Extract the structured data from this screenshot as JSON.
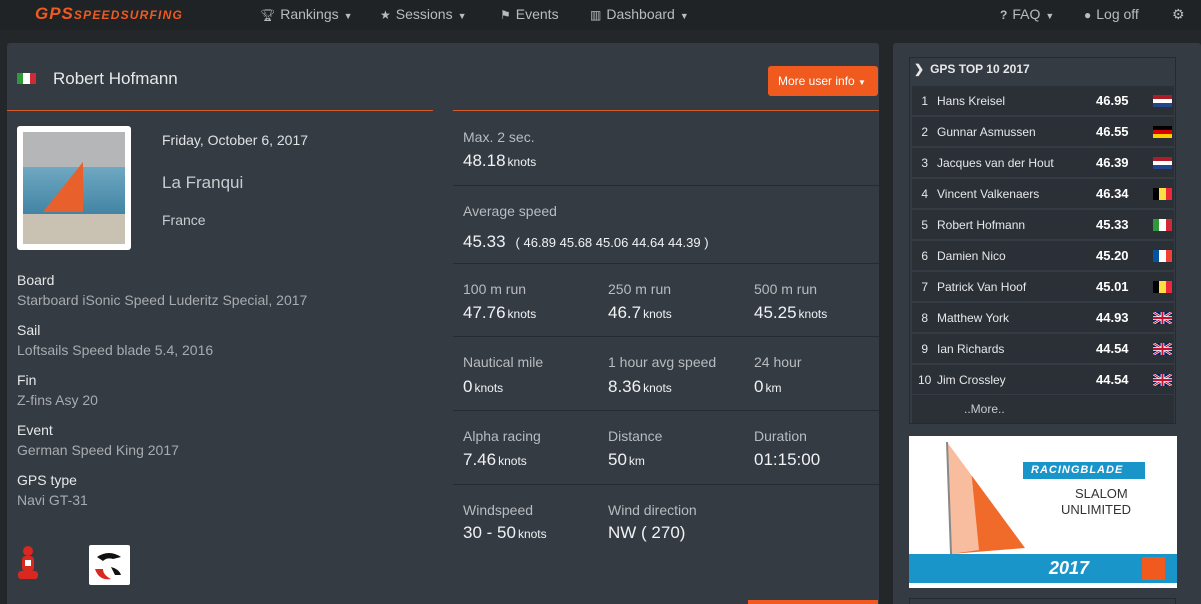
{
  "nav": {
    "logo_big": "GPS",
    "logo_small": "SPEEDSURFING",
    "rankings": "Rankings",
    "sessions": "Sessions",
    "events": "Events",
    "dashboard": "Dashboard",
    "faq": "FAQ",
    "logout": "Log off"
  },
  "user": {
    "name": "Robert Hofmann",
    "more_info": "More user info"
  },
  "session": {
    "date": "Friday, October 6, 2017",
    "location": "La Franqui",
    "country": "France"
  },
  "details": [
    {
      "label": "Board",
      "value": "Starboard iSonic Speed Luderitz Special, 2017"
    },
    {
      "label": "Sail",
      "value": "Loftsails Speed blade 5.4, 2016"
    },
    {
      "label": "Fin",
      "value": "Z-fins Asy 20"
    },
    {
      "label": "Event",
      "value": "German Speed King 2017"
    },
    {
      "label": "GPS type",
      "value": "Navi GT-31"
    }
  ],
  "stats": {
    "max2": {
      "label": "Max. 2 sec.",
      "value": "48.18",
      "unit": "knots"
    },
    "avg": {
      "label": "Average speed",
      "value": "45.33",
      "runs": "( 46.89 45.68 45.06 44.64 44.39 )"
    },
    "r100": {
      "label": "100 m run",
      "value": "47.76",
      "unit": "knots"
    },
    "r250": {
      "label": "250 m run",
      "value": "46.7",
      "unit": "knots"
    },
    "r500": {
      "label": "500 m run",
      "value": "45.25",
      "unit": "knots"
    },
    "nm": {
      "label": "Nautical mile",
      "value": "0",
      "unit": "knots"
    },
    "hour": {
      "label": "1 hour avg speed",
      "value": "8.36",
      "unit": "knots"
    },
    "h24": {
      "label": "24 hour",
      "value": "0",
      "unit": "km"
    },
    "alpha": {
      "label": "Alpha racing",
      "value": "7.46",
      "unit": "knots"
    },
    "dist": {
      "label": "Distance",
      "value": "50",
      "unit": "km"
    },
    "dur": {
      "label": "Duration",
      "value": "01:15:00"
    },
    "wind": {
      "label": "Windspeed",
      "value": "30 - 50",
      "unit": "knots"
    },
    "dir": {
      "label": "Wind direction",
      "value": "NW ( 270)"
    }
  },
  "top10": {
    "title": "GPS TOP 10 2017",
    "more": "..More..",
    "rows": [
      {
        "rank": "1",
        "name": "Hans Kreisel",
        "speed": "46.95",
        "flag": "nl"
      },
      {
        "rank": "2",
        "name": "Gunnar Asmussen",
        "speed": "46.55",
        "flag": "de"
      },
      {
        "rank": "3",
        "name": "Jacques van der Hout",
        "speed": "46.39",
        "flag": "nl"
      },
      {
        "rank": "4",
        "name": "Vincent Valkenaers",
        "speed": "46.34",
        "flag": "be"
      },
      {
        "rank": "5",
        "name": "Robert Hofmann",
        "speed": "45.33",
        "flag": "it"
      },
      {
        "rank": "6",
        "name": "Damien Nico",
        "speed": "45.20",
        "flag": "fr"
      },
      {
        "rank": "7",
        "name": "Patrick Van Hoof",
        "speed": "45.01",
        "flag": "be"
      },
      {
        "rank": "8",
        "name": "Matthew York",
        "speed": "44.93",
        "flag": "gb"
      },
      {
        "rank": "9",
        "name": "Ian Richards",
        "speed": "44.54",
        "flag": "gb"
      },
      {
        "rank": "10",
        "name": "Jim Crossley",
        "speed": "44.54",
        "flag": "gb"
      }
    ]
  },
  "ad": {
    "brand": "RACINGBLADE",
    "line1": "SLALOM",
    "line2": "UNLIMITED",
    "year": "2017"
  },
  "colors": {
    "accent": "#f05a1f",
    "panel": "#353b42",
    "background": "#23272a"
  }
}
